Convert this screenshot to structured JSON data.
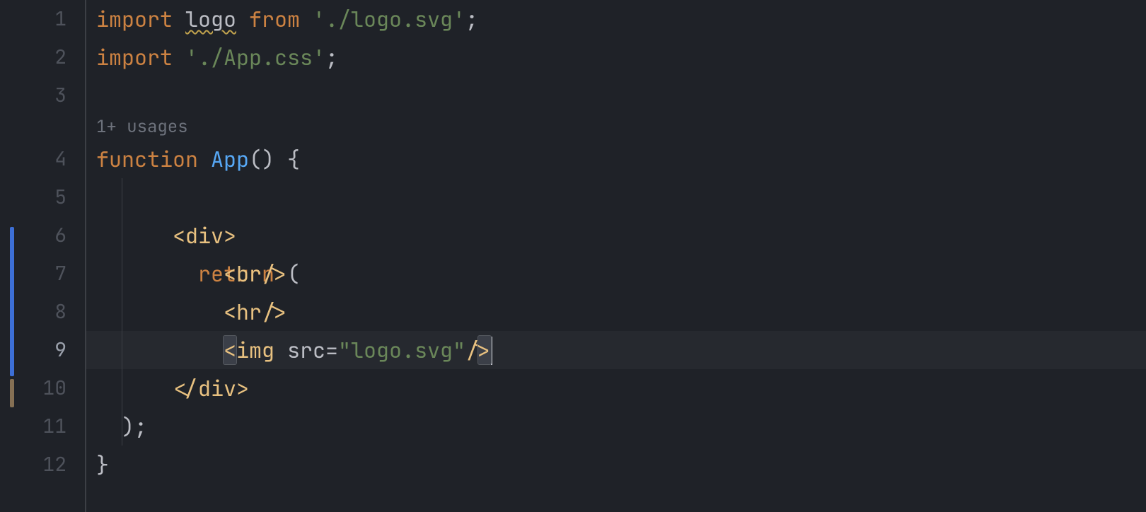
{
  "editor": {
    "current_line": 9,
    "inlay_hint": "1+ usages",
    "lines": [
      {
        "num": 1
      },
      {
        "num": 2
      },
      {
        "num": 3
      },
      {
        "num": 4
      },
      {
        "num": 5
      },
      {
        "num": 6
      },
      {
        "num": 7
      },
      {
        "num": 8
      },
      {
        "num": 9
      },
      {
        "num": 10
      },
      {
        "num": 11
      },
      {
        "num": 12
      }
    ],
    "tokens": {
      "l1": {
        "kw_import": "import",
        "id_logo": "logo",
        "kw_from": "from",
        "str_path": "'./logo.svg'",
        "semi": ";"
      },
      "l2": {
        "kw_import": "import",
        "str_path": "'./App.css'",
        "semi": ";"
      },
      "l4": {
        "kw_function": "function",
        "fn_name": "App",
        "parens": "()",
        "brace_open": "{"
      },
      "l5": {
        "kw_return": "return",
        "paren_open": "("
      },
      "l6": {
        "tag_open": "<div>"
      },
      "l7": {
        "tag_br": "<br/>"
      },
      "l8": {
        "tag_hr": "<hr/>"
      },
      "l9": {
        "tag_open": "<",
        "tag_name": "img",
        "attr_name": "src",
        "eq": "=",
        "attr_val": "\"logo.svg\"",
        "tag_close": "/>"
      },
      "l10": {
        "tag_close": "</div>"
      },
      "l11": {
        "paren_close": ")",
        "semi": ";"
      },
      "l12": {
        "brace_close": "}"
      }
    }
  }
}
